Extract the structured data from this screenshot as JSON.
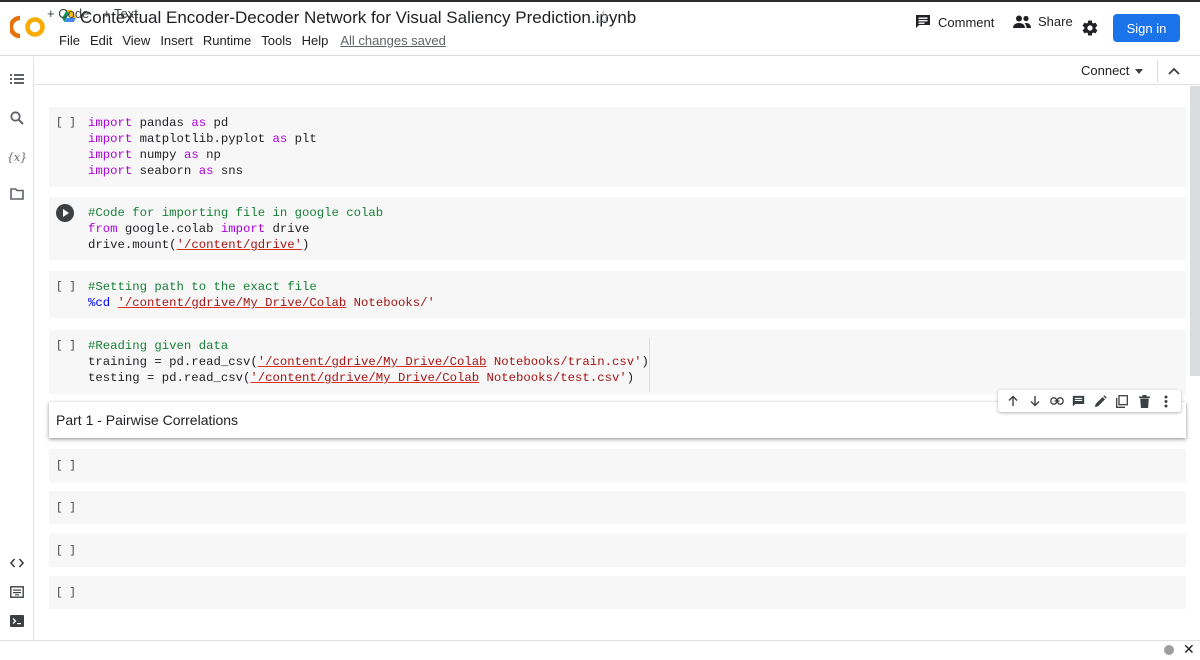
{
  "header": {
    "logo_text": "CO",
    "title": "Contextual Encoder-Decoder Network  for Visual Saliency Prediction.ipynb",
    "menu": [
      "File",
      "Edit",
      "View",
      "Insert",
      "Runtime",
      "Tools",
      "Help"
    ],
    "save_status": "All changes saved",
    "comment_label": "Comment",
    "share_label": "Share",
    "signin_label": "Sign in"
  },
  "toolbar": {
    "add_code": "+ Code",
    "add_text": "+ Text",
    "connect": "Connect"
  },
  "cells": {
    "c1": {
      "bracket": "[ ]",
      "lines": [
        [
          {
            "t": "import",
            "c": "kw"
          },
          {
            "t": " pandas "
          },
          {
            "t": "as",
            "c": "kw"
          },
          {
            "t": " pd"
          }
        ],
        [
          {
            "t": "import",
            "c": "kw"
          },
          {
            "t": " matplotlib.pyplot "
          },
          {
            "t": "as",
            "c": "kw"
          },
          {
            "t": " plt"
          }
        ],
        [
          {
            "t": "import",
            "c": "kw"
          },
          {
            "t": " numpy "
          },
          {
            "t": "as",
            "c": "kw"
          },
          {
            "t": " np"
          }
        ],
        [
          {
            "t": "import",
            "c": "kw"
          },
          {
            "t": " seaborn "
          },
          {
            "t": "as",
            "c": "kw"
          },
          {
            "t": " sns"
          }
        ]
      ]
    },
    "c2": {
      "lines": [
        [
          {
            "t": "#Code for importing file in google colab",
            "c": "cm"
          }
        ],
        [
          {
            "t": "from",
            "c": "kw"
          },
          {
            "t": " google.colab "
          },
          {
            "t": "import",
            "c": "kw"
          },
          {
            "t": " drive"
          }
        ],
        [
          {
            "t": "drive.mount("
          },
          {
            "t": "'/content/gdrive'",
            "c": "st-ul"
          },
          {
            "t": ")"
          }
        ]
      ]
    },
    "c3": {
      "bracket": "[ ]",
      "lines": [
        [
          {
            "t": "#Setting path to the exact file",
            "c": "cm"
          }
        ],
        [
          {
            "t": "%cd",
            "c": "pct"
          },
          {
            "t": " "
          },
          {
            "t": "'/content/gdrive/My Drive/Colab",
            "c": "st-ul"
          },
          {
            "t": " Notebooks/'",
            "c": "st"
          }
        ]
      ]
    },
    "c4": {
      "bracket": "[ ]",
      "lines": [
        [
          {
            "t": "#Reading given data",
            "c": "cm"
          }
        ],
        [
          {
            "t": "training = pd.read_csv("
          },
          {
            "t": "'/content/gdrive/My Drive/Colab",
            "c": "st-ul"
          },
          {
            "t": " Notebooks/train.csv'",
            "c": "st"
          },
          {
            "t": ")"
          }
        ],
        [
          {
            "t": "testing = pd.read_csv("
          },
          {
            "t": "'/content/gdrive/My Drive/Colab",
            "c": "st-ul"
          },
          {
            "t": " Notebooks/test.csv'",
            "c": "st"
          },
          {
            "t": ")"
          }
        ]
      ]
    },
    "text_cell": "Part 1 - Pairwise Correlations",
    "empty_bracket": "[ ]"
  },
  "colors": {
    "accent": "#1a73e8",
    "keyword": "#af00db",
    "comment": "#188038",
    "string": "#a31515"
  }
}
